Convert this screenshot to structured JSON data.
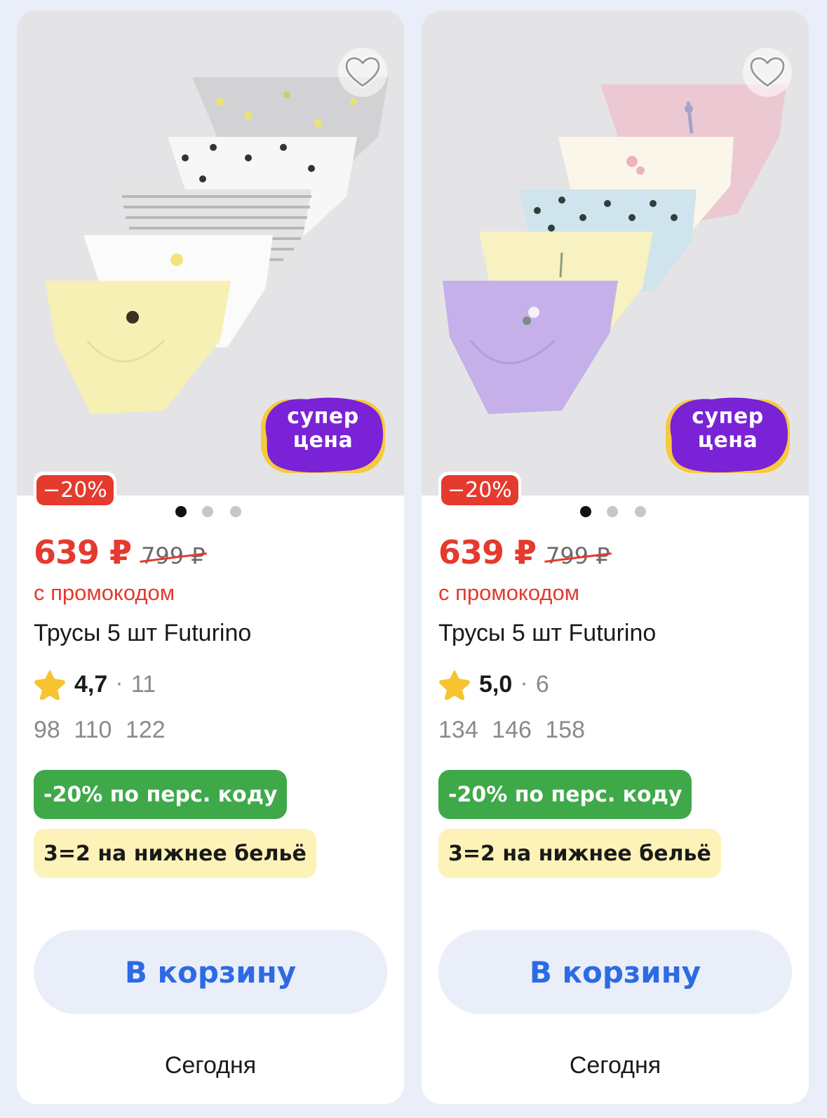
{
  "colors": {
    "page_bg": "#e9eef8",
    "price_red": "#e53a2e",
    "green_badge": "#3fa94a",
    "yellow_badge": "#fdf3b8",
    "cart_text": "#2d6be4",
    "super_price_purple": "#7a22d6",
    "super_price_yellow": "#f7c93c"
  },
  "products": [
    {
      "image_dots": {
        "count": 3,
        "active": 1
      },
      "super_price": {
        "line1": "супер",
        "line2": "цена"
      },
      "discount_badge": "−20%",
      "price": "639 ₽",
      "old_price": "799 ₽",
      "promo_note": "с промокодом",
      "title": "Трусы 5 шт Futurino",
      "rating": {
        "score": "4,7",
        "separator": "·",
        "count": "11"
      },
      "sizes": "98  110  122",
      "badges": {
        "promo_code": "-20% по перс. коду",
        "offer": "3=2 на нижнее бельё"
      },
      "cart_label": "В корзину",
      "delivery": "Сегодня",
      "icons": {
        "favorite": "heart-icon",
        "rating": "star-icon"
      }
    },
    {
      "image_dots": {
        "count": 3,
        "active": 1
      },
      "super_price": {
        "line1": "супер",
        "line2": "цена"
      },
      "discount_badge": "−20%",
      "price": "639 ₽",
      "old_price": "799 ₽",
      "promo_note": "с промокодом",
      "title": "Трусы 5 шт Futurino",
      "rating": {
        "score": "5,0",
        "separator": "·",
        "count": "6"
      },
      "sizes": "134  146  158",
      "badges": {
        "promo_code": "-20% по перс. коду",
        "offer": "3=2 на нижнее бельё"
      },
      "cart_label": "В корзину",
      "delivery": "Сегодня",
      "icons": {
        "favorite": "heart-icon",
        "rating": "star-icon"
      }
    }
  ]
}
